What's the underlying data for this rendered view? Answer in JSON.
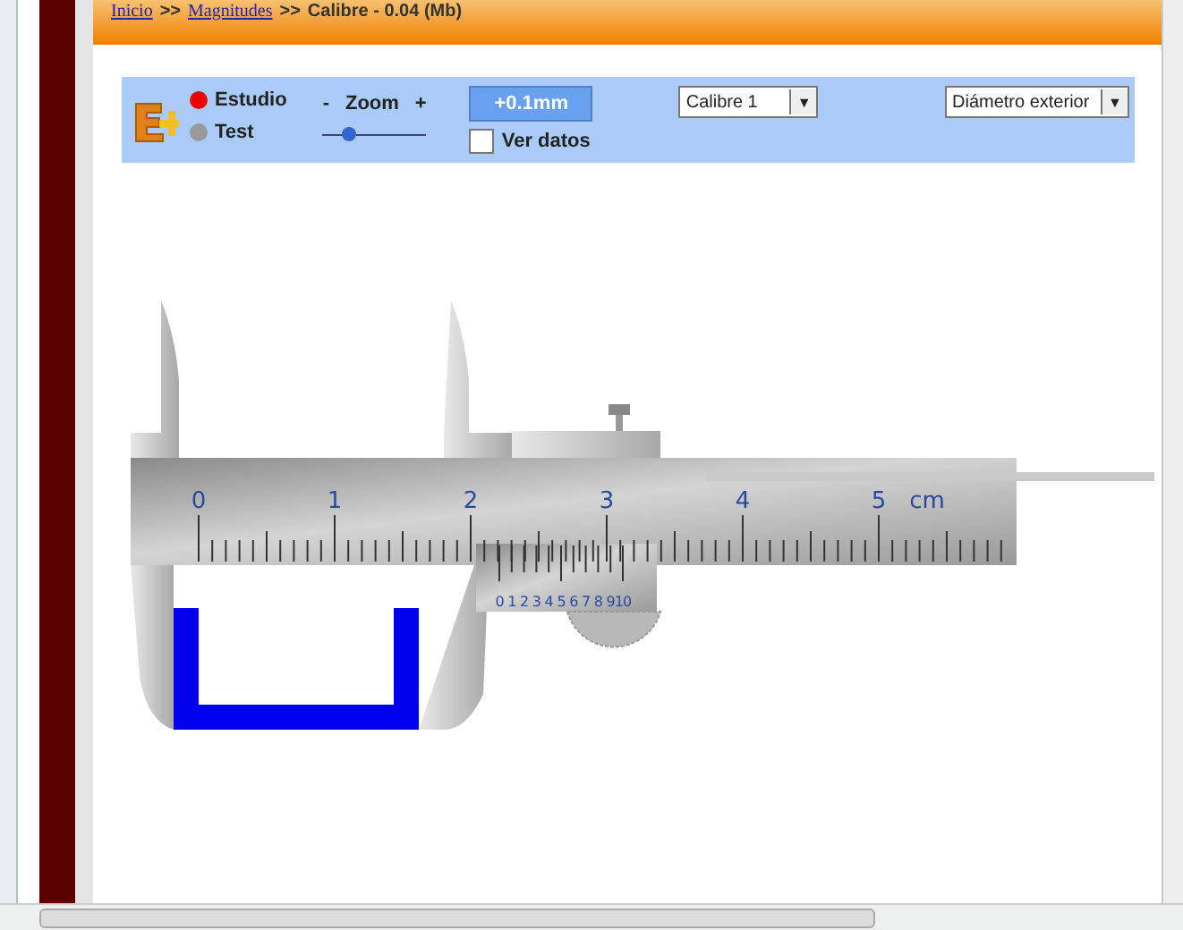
{
  "breadcrumb": {
    "links": [
      "Inicio",
      "Magnitudes"
    ],
    "separator": ">>",
    "current": "Calibre - 0.04 (Mb)"
  },
  "toolbar": {
    "modes": [
      {
        "label": "Estudio",
        "selected": true
      },
      {
        "label": "Test",
        "selected": false
      }
    ],
    "zoom": {
      "minus": "-",
      "label": "Zoom",
      "plus": "+",
      "level": 0.25
    },
    "step_button": "+0.1mm",
    "show_data": {
      "label": "Ver datos",
      "checked": false
    },
    "instrument_select": {
      "value": "Calibre 1",
      "arrow": "▼"
    },
    "measure_select": {
      "value": "Diámetro exterior",
      "arrow": "▼"
    }
  },
  "caliper": {
    "main_scale": [
      "0",
      "1",
      "2",
      "3",
      "4",
      "5"
    ],
    "unit": "cm",
    "vernier_scale": [
      "0",
      "1",
      "2",
      "3",
      "4",
      "5",
      "6",
      "7",
      "8",
      "9",
      "10"
    ]
  }
}
